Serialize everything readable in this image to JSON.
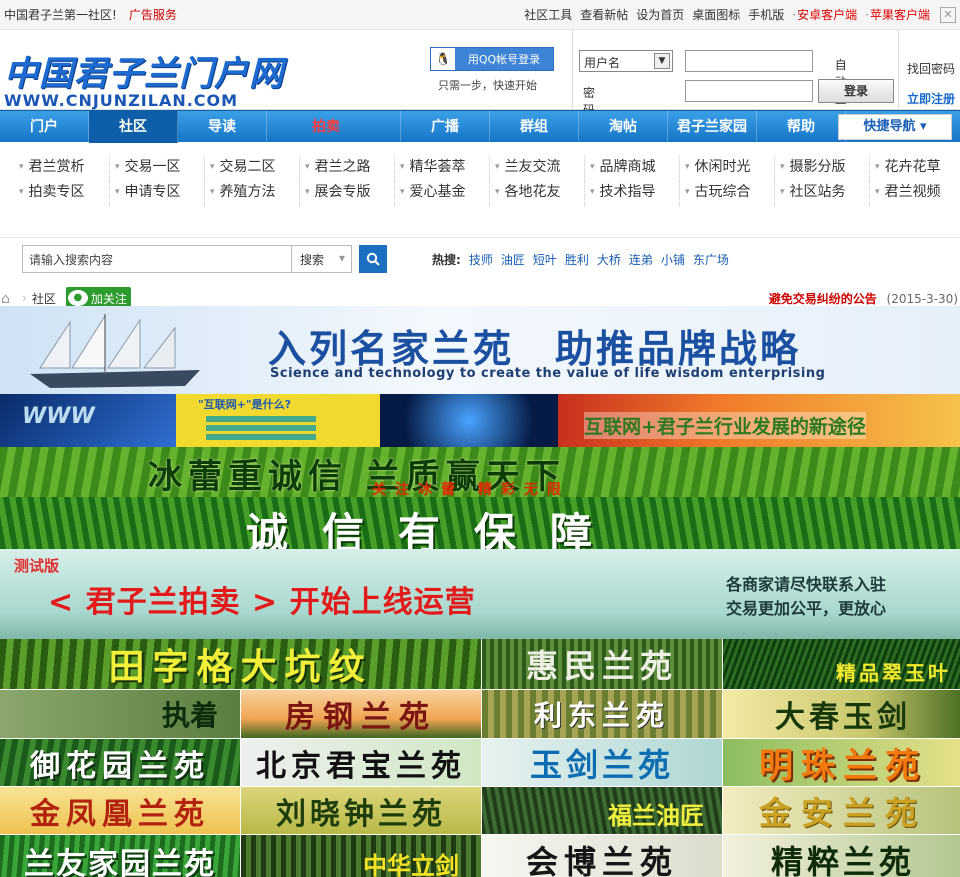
{
  "topbar": {
    "site_tagline": "中国君子兰第一社区!",
    "ad_service": "广告服务",
    "links": [
      "社区工具",
      "查看新帖",
      "设为首页",
      "桌面图标",
      "手机版"
    ],
    "app_links": [
      "安卓客户端",
      "苹果客户端"
    ],
    "close_icon": "close-icon"
  },
  "header": {
    "logo_cn": "中国君子兰门户网",
    "logo_en": "WWW.CNJUNZILAN.COM",
    "qq_login": "用QQ帐号登录",
    "qq_sub": "只需一步，快速开始",
    "username_select": "用户名",
    "password_label": "密码",
    "auto_login": "自动登录",
    "login_button": "登录",
    "forgot_password": "找回密码",
    "register": "立即注册"
  },
  "nav": {
    "items": [
      "门户",
      "社区",
      "导读",
      "拍卖",
      "广播",
      "群组",
      "淘帖",
      "君子兰家园",
      "帮助"
    ],
    "active": "社区",
    "quick_nav": "快捷导航 ▾"
  },
  "subnav": {
    "row1": [
      "君兰赏析",
      "交易一区",
      "交易二区",
      "君兰之路",
      "精华荟萃",
      "兰友交流",
      "品牌商城",
      "休闲时光",
      "摄影分版",
      "花卉花草"
    ],
    "row2": [
      "拍卖专区",
      "申请专区",
      "养殖方法",
      "展会专版",
      "爱心基金",
      "各地花友",
      "技术指导",
      "古玩综合",
      "社区站务",
      "君兰视频"
    ]
  },
  "search": {
    "placeholder": "请输入搜索内容",
    "scope": "搜索",
    "hot_label": "热搜:",
    "hot_keywords": [
      "技师",
      "油匠",
      "短叶",
      "胜利",
      "大桥",
      "连弟",
      "小铺",
      "东广场"
    ]
  },
  "breadcrumb": {
    "current": "社区",
    "follow": "加关注",
    "notice_title": "避免交易纠纷的公告",
    "notice_date": "(2015-3-30)"
  },
  "banners": {
    "b1_title": "入列名家兰苑　助推品牌战略",
    "b1_sub": "Science and technology to create the value of life wisdom enterprising",
    "b2_www": "WWW",
    "b2_q": "\"互联网+\"是什么?",
    "b2_right": "互联网+君子兰行业发展的新途径",
    "b3_title": "冰蕾重诚信 兰质赢天下",
    "b3_sub": "关注冰蕾 精彩无限",
    "b4_title": "诚信有保障",
    "b5_test": "测试版",
    "b5_title": "< 君子兰拍卖 > 开始上线运营",
    "b5_r1": "各商家请尽快联系入驻",
    "b5_r2": "交易更加公平，更放心"
  },
  "tiles": [
    "田字格大坑纹",
    "惠民兰苑",
    "精品翠玉叶",
    "执着",
    "房钢兰苑",
    "利东兰苑",
    "大春玉剑",
    "御花园兰苑",
    "北京君宝兰苑",
    "玉剑兰苑",
    "明珠兰苑",
    "金凤凰兰苑",
    "刘晓钟兰苑",
    "福兰油匠",
    "金安兰苑",
    "兰友家园兰苑",
    "中华立剑",
    "会博兰苑",
    "精粹兰苑"
  ]
}
